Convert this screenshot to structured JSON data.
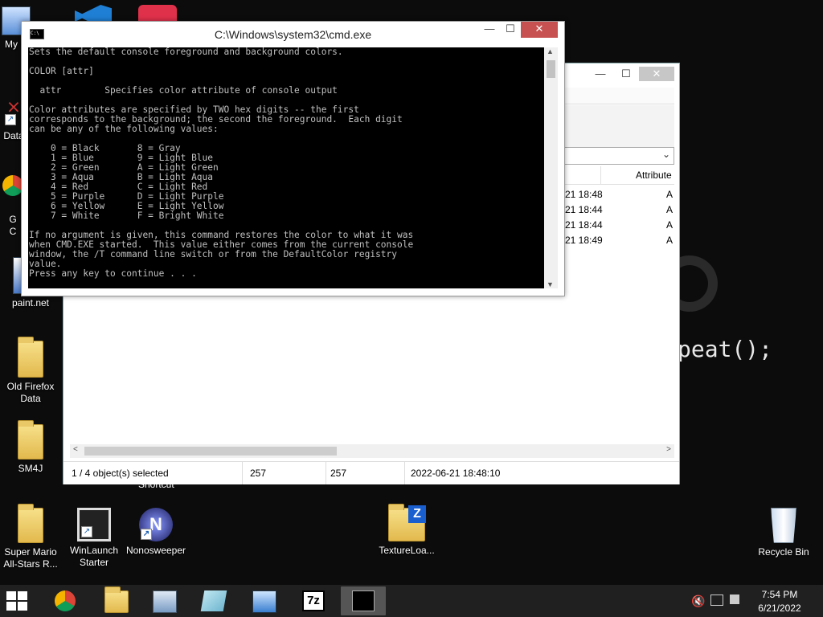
{
  "desktop": {
    "icons": [
      {
        "label": "My C"
      },
      {
        "label": "Data"
      },
      {
        "label": "G"
      },
      {
        "label": "C"
      },
      {
        "label": "paint.net"
      },
      {
        "label": "Old Firefox Data"
      },
      {
        "label": "SM4J"
      },
      {
        "label": "Super Mario All-Stars R..."
      },
      {
        "label": "WinLaunch Starter"
      },
      {
        "label": "Nonosweeper"
      },
      {
        "label": "TextureLoa..."
      },
      {
        "label": "Recycle Bin"
      },
      {
        "label": "Shortcut"
      }
    ],
    "background_code": "peat();"
  },
  "explorer": {
    "column_attributes": "Attribute",
    "rows": [
      {
        "date": "21 18:48",
        "attr": "A"
      },
      {
        "date": "21 18:44",
        "attr": "A"
      },
      {
        "date": "21 18:44",
        "attr": "A"
      },
      {
        "date": "21 18:49",
        "attr": "A"
      }
    ],
    "status": {
      "selection": "1 / 4 object(s) selected",
      "size": "257",
      "packed": "257",
      "modified": "2022-06-21 18:48:10"
    }
  },
  "cmd": {
    "title": "C:\\Windows\\system32\\cmd.exe",
    "output": "Sets the default console foreground and background colors.\n\nCOLOR [attr]\n\n  attr        Specifies color attribute of console output\n\nColor attributes are specified by TWO hex digits -- the first\ncorresponds to the background; the second the foreground.  Each digit\ncan be any of the following values:\n\n    0 = Black       8 = Gray\n    1 = Blue        9 = Light Blue\n    2 = Green       A = Light Green\n    3 = Aqua        B = Light Aqua\n    4 = Red         C = Light Red\n    5 = Purple      D = Light Purple\n    6 = Yellow      E = Light Yellow\n    7 = White       F = Bright White\n\nIf no argument is given, this command restores the color to what it was\nwhen CMD.EXE started.  This value either comes from the current console\nwindow, the /T command line switch or from the DefaultColor registry\nvalue.\nPress any key to continue . . ."
  },
  "taskbar": {
    "apps": [
      {
        "name": "chrome-icon"
      },
      {
        "name": "file-explorer-icon"
      },
      {
        "name": "remote-desktop-icon"
      },
      {
        "name": "notepad-icon"
      },
      {
        "name": "control-panel-icon"
      },
      {
        "name": "7zip-icon",
        "label": "7z"
      },
      {
        "name": "cmd-icon",
        "active": true
      }
    ],
    "clock": {
      "time": "7:54 PM",
      "date": "6/21/2022"
    }
  },
  "colors": {
    "taskbar": "#202020",
    "cmd_close": "#c75050",
    "console_text": "#c0c0c0"
  }
}
